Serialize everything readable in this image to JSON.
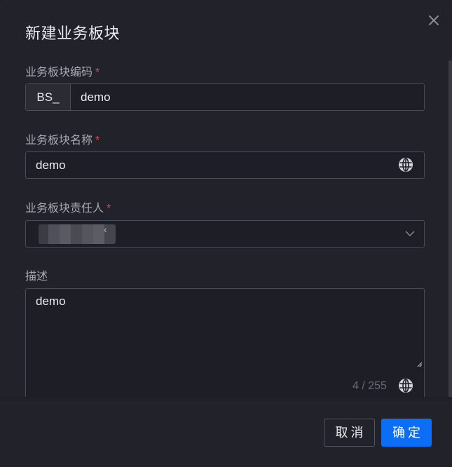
{
  "dialog": {
    "title": "新建业务板块",
    "close_icon": "close-icon"
  },
  "form": {
    "code": {
      "label": "业务板块编码",
      "required_mark": "*",
      "prefix": "BS_",
      "value": "demo"
    },
    "name": {
      "label": "业务板块名称",
      "required_mark": "*",
      "value": "demo",
      "icon": "globe-icon"
    },
    "owner": {
      "label": "业务板块责任人",
      "required_mark": "*",
      "selected_tag": "[redacted]",
      "tag_close_glyph": "‹",
      "icon": "chevron-down-icon"
    },
    "description": {
      "label": "描述",
      "value": "demo",
      "counter": "4 / 255",
      "icon": "globe-icon"
    }
  },
  "footer": {
    "cancel_label": "取消",
    "confirm_label": "确定"
  },
  "colors": {
    "background": "#22222b",
    "accent": "#0b6ef5",
    "required": "#e5484d",
    "border": "#4b4b55"
  }
}
